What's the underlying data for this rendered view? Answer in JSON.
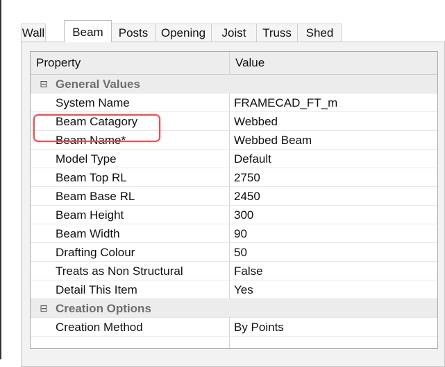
{
  "tabs": [
    {
      "label": "Wall",
      "active": false
    },
    {
      "label": "Beam",
      "active": true
    },
    {
      "label": "Posts",
      "active": false
    },
    {
      "label": "Opening",
      "active": false
    },
    {
      "label": "Joist",
      "active": false
    },
    {
      "label": "Truss",
      "active": false
    },
    {
      "label": "Shed",
      "active": false
    }
  ],
  "grid": {
    "columns": [
      "Property",
      "Value"
    ],
    "rows": [
      {
        "kind": "category",
        "glyph": "⊟",
        "label": "General Values"
      },
      {
        "kind": "item",
        "name": "System Name",
        "value": "FRAMECAD_FT_m"
      },
      {
        "kind": "item",
        "name": "Beam Catagory",
        "value": "Webbed"
      },
      {
        "kind": "item",
        "name": "Beam Name*",
        "value": "Webbed Beam",
        "highlighted": true
      },
      {
        "kind": "item",
        "name": "Model Type",
        "value": "Default"
      },
      {
        "kind": "item",
        "name": "Beam Top RL",
        "value": "2750"
      },
      {
        "kind": "item",
        "name": "Beam Base RL",
        "value": "2450"
      },
      {
        "kind": "item",
        "name": "Beam Height",
        "value": "300"
      },
      {
        "kind": "item",
        "name": "Beam Width",
        "value": "90"
      },
      {
        "kind": "item",
        "name": "Drafting Colour",
        "value": "50"
      },
      {
        "kind": "item",
        "name": "Treats as Non Structural",
        "value": "False"
      },
      {
        "kind": "item",
        "name": "Detail This Item",
        "value": "Yes"
      },
      {
        "kind": "category",
        "glyph": "⊟",
        "label": "Creation Options"
      },
      {
        "kind": "item",
        "name": "Creation Method",
        "value": "By Points"
      }
    ]
  },
  "colors": {
    "highlight": "#e05252",
    "category_bg": "#ececec",
    "header_bg": "#ededed"
  }
}
